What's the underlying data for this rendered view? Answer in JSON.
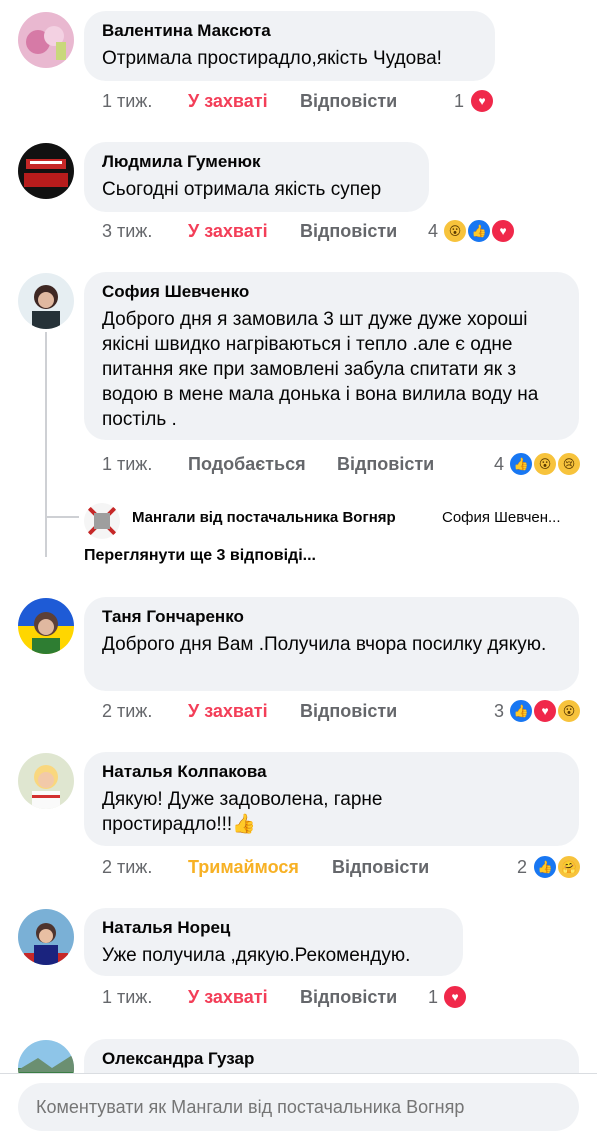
{
  "comments": [
    {
      "author": "Валентина Максюта",
      "text": "Отримала простирадло,якість Чудова!",
      "time": "1 тиж.",
      "reaction_label": "У захваті",
      "reply_label": "Відповісти",
      "reaction_count": "1",
      "reactions": [
        "love"
      ]
    },
    {
      "author": "Людмила Гуменюк",
      "text": "Сьогодні отримала якість супер",
      "time": "3 тиж.",
      "reaction_label": "У захваті",
      "reply_label": "Відповісти",
      "reaction_count": "4",
      "reactions": [
        "wow",
        "like",
        "love"
      ]
    },
    {
      "author": "София Шевченко",
      "text": "Доброго дня я замовила 3 шт дуже дуже хороші якісні швидко нагріваються і тепло .але є одне питання яке при замовлені забула спитати як з водою в мене мала донька і вона вилила воду на постіль .",
      "time": "1 тиж.",
      "reaction_label": "Подобається",
      "reply_label": "Відповісти",
      "reaction_count": "4",
      "reactions": [
        "like",
        "wow",
        "sad"
      ],
      "reply": {
        "author": "Мангали від постачальника Вогняр",
        "preview": "София Шевчен..."
      },
      "more_replies": "Переглянути ще 3 відповіді..."
    },
    {
      "author": "Таня Гончаренко",
      "text": "Доброго дня Вам .Получила вчора посилку дякую.",
      "time": "2 тиж.",
      "reaction_label": "У захваті",
      "reply_label": "Відповісти",
      "reaction_count": "3",
      "reactions": [
        "like",
        "love",
        "wow"
      ]
    },
    {
      "author": "Наталья Колпакова",
      "text": "Дякую! Дуже задоволена, гарне простирадло!!!👍",
      "time": "2 тиж.",
      "reaction_label": "Тримаймося",
      "reply_label": "Відповісти",
      "reaction_count": "2",
      "reactions": [
        "like",
        "care"
      ]
    },
    {
      "author": "Наталья Норец",
      "text": "Уже получила ,дякую.Рекомендую.",
      "time": "1 тиж.",
      "reaction_label": "У захваті",
      "reply_label": "Відповісти",
      "reaction_count": "1",
      "reactions": [
        "love"
      ]
    },
    {
      "author": "Олександра Гузар",
      "text": ""
    }
  ],
  "composer": {
    "placeholder": "Коментувати як Мангали від постачальника Вогняр"
  },
  "colors": {
    "love": "#f33e58",
    "care": "#f7b125",
    "bubble": "#f0f2f5",
    "muted": "#65676b"
  }
}
